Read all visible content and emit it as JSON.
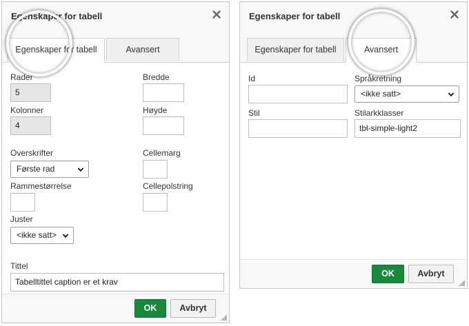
{
  "left_dialog": {
    "title": "Egenskaper for tabell",
    "tabs": [
      {
        "label": "Egenskaper for tabell",
        "active": true
      },
      {
        "label": "Avansert",
        "active": false
      }
    ],
    "fields": {
      "rows": {
        "label": "Rader",
        "value": "5"
      },
      "columns": {
        "label": "Kolonner",
        "value": "4"
      },
      "width": {
        "label": "Bredde",
        "value": ""
      },
      "height": {
        "label": "Høyde",
        "value": ""
      },
      "headers": {
        "label": "Overskrifter",
        "value": "Første rad"
      },
      "cell_spacing": {
        "label": "Cellemarg",
        "value": ""
      },
      "border_size": {
        "label": "Rammestørrelse",
        "value": ""
      },
      "cell_padding": {
        "label": "Cellepolstring",
        "value": ""
      },
      "align": {
        "label": "Juster",
        "value": "<ikke satt>"
      },
      "caption": {
        "label": "Tittel",
        "value": "Tabelltittel caption er et krav"
      }
    },
    "ok_label": "OK",
    "cancel_label": "Avbryt"
  },
  "right_dialog": {
    "title": "Egenskaper for tabell",
    "tabs": [
      {
        "label": "Egenskaper for tabell",
        "active": false
      },
      {
        "label": "Avansert",
        "active": true
      }
    ],
    "fields": {
      "id": {
        "label": "Id",
        "value": ""
      },
      "lang_dir": {
        "label": "Språkretning",
        "value": "<ikke satt>"
      },
      "style": {
        "label": "Stil",
        "value": ""
      },
      "css_classes": {
        "label": "Stilarkklasser",
        "value": "tbl-simple-light2"
      }
    },
    "ok_label": "OK",
    "cancel_label": "Avbryt"
  },
  "colors": {
    "ok_button": "#168a3a",
    "readonly_field": "#e6e6e6",
    "header_bg": "#f8f8f8"
  }
}
